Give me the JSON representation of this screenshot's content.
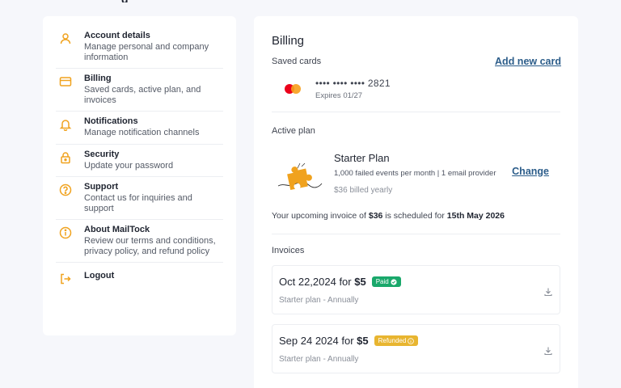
{
  "colors": {
    "accent_orange": "#f0a21e",
    "link_blue": "#2c5d8a",
    "paid_green": "#1aa86b",
    "refunded_yellow": "#e8b530"
  },
  "sidebar": {
    "items": [
      {
        "icon": "user-icon",
        "title": "Account details",
        "desc": "Manage personal and company information"
      },
      {
        "icon": "credit-card-icon",
        "title": "Billing",
        "desc": "Saved cards, active plan, and invoices"
      },
      {
        "icon": "bell-icon",
        "title": "Notifications",
        "desc": "Manage notification channels"
      },
      {
        "icon": "lock-icon",
        "title": "Security",
        "desc": "Update your password"
      },
      {
        "icon": "question-icon",
        "title": "Support",
        "desc": "Contact us for inquiries and support"
      },
      {
        "icon": "info-icon",
        "title": "About MailTock",
        "desc": "Review our terms and conditions, privacy policy, and refund policy"
      },
      {
        "icon": "logout-icon",
        "title": "Logout",
        "desc": ""
      }
    ]
  },
  "billing": {
    "title": "Billing",
    "saved_cards_label": "Saved cards",
    "add_card_label": "Add new card",
    "card": {
      "brand_icon": "mastercard-icon",
      "number": "•••• •••• •••• 2821",
      "expires": "Expires 01/27"
    },
    "active_plan_label": "Active plan",
    "plan": {
      "name": "Starter Plan",
      "features": "1,000 failed events per month | 1 email provider",
      "price": "$36 billed yearly",
      "change_label": "Change"
    },
    "upcoming": {
      "prefix": "Your upcoming invoice of ",
      "amount": "$36",
      "middle": " is scheduled for ",
      "date": "15th May 2026"
    },
    "invoices_label": "Invoices",
    "invoices": [
      {
        "date": "Oct 22,2024 for ",
        "amount": "$5",
        "status": "Paid",
        "status_color": "#1aa86b",
        "plan": "Starter plan - Annually"
      },
      {
        "date": "Sep 24 2024 for ",
        "amount": "$5",
        "status": "Refunded",
        "status_color": "#e8b530",
        "plan": "Starter plan - Annually"
      }
    ]
  }
}
